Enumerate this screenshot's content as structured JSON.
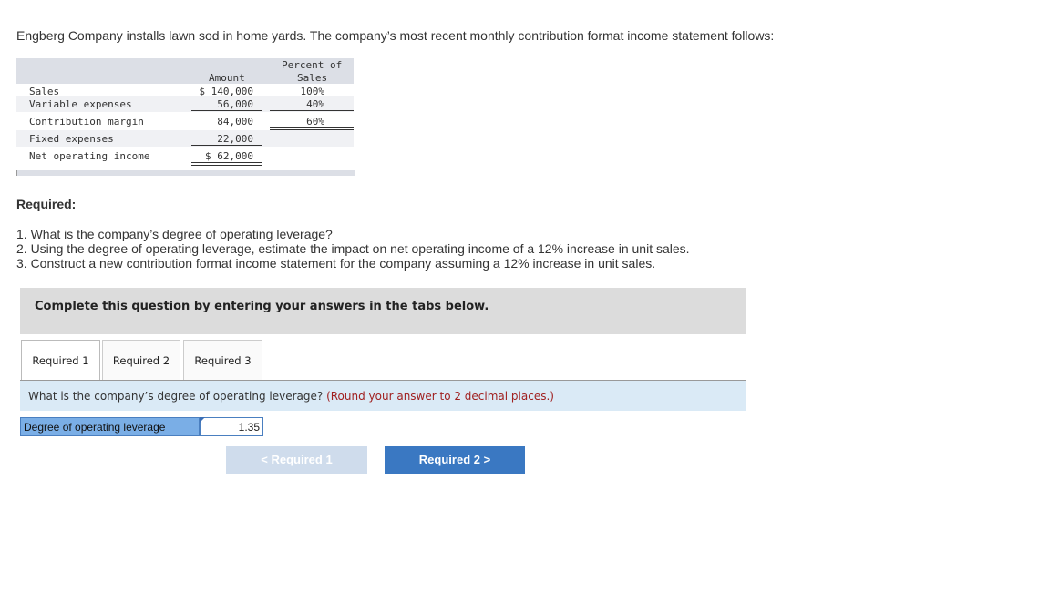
{
  "intro": "Engberg Company installs lawn sod in home yards. The company’s most recent monthly contribution format income statement follows:",
  "statement": {
    "header_amount": "Amount",
    "header_pct_line1": "Percent of",
    "header_pct_line2": "Sales",
    "rows": [
      {
        "label": "Sales",
        "amount": "$ 140,000",
        "percent": "100%"
      },
      {
        "label": "Variable expenses",
        "amount": "56,000",
        "percent": "40%"
      },
      {
        "label": "Contribution margin",
        "amount": "84,000",
        "percent": "60%"
      },
      {
        "label": "Fixed expenses",
        "amount": "22,000",
        "percent": ""
      },
      {
        "label": "Net operating income",
        "amount": "$  62,000",
        "percent": ""
      }
    ]
  },
  "required_title": "Required:",
  "questions": [
    "1. What is the company’s degree of operating leverage?",
    "2. Using the degree of operating leverage, estimate the impact on net operating income of a 12% increase in unit sales.",
    "3. Construct a new contribution format income statement for the company assuming a 12% increase in unit sales."
  ],
  "panel_text": "Complete this question by entering your answers in the tabs below.",
  "tabs": [
    "Required 1",
    "Required 2",
    "Required 3"
  ],
  "question_bar": {
    "text": "What is the company’s degree of operating leverage? ",
    "hint": "(Round your answer to 2 decimal places.)"
  },
  "answer": {
    "label": "Degree of operating leverage",
    "value": "1.35"
  },
  "nav": {
    "prev": "<  Required 1",
    "next": "Required 2  >"
  }
}
